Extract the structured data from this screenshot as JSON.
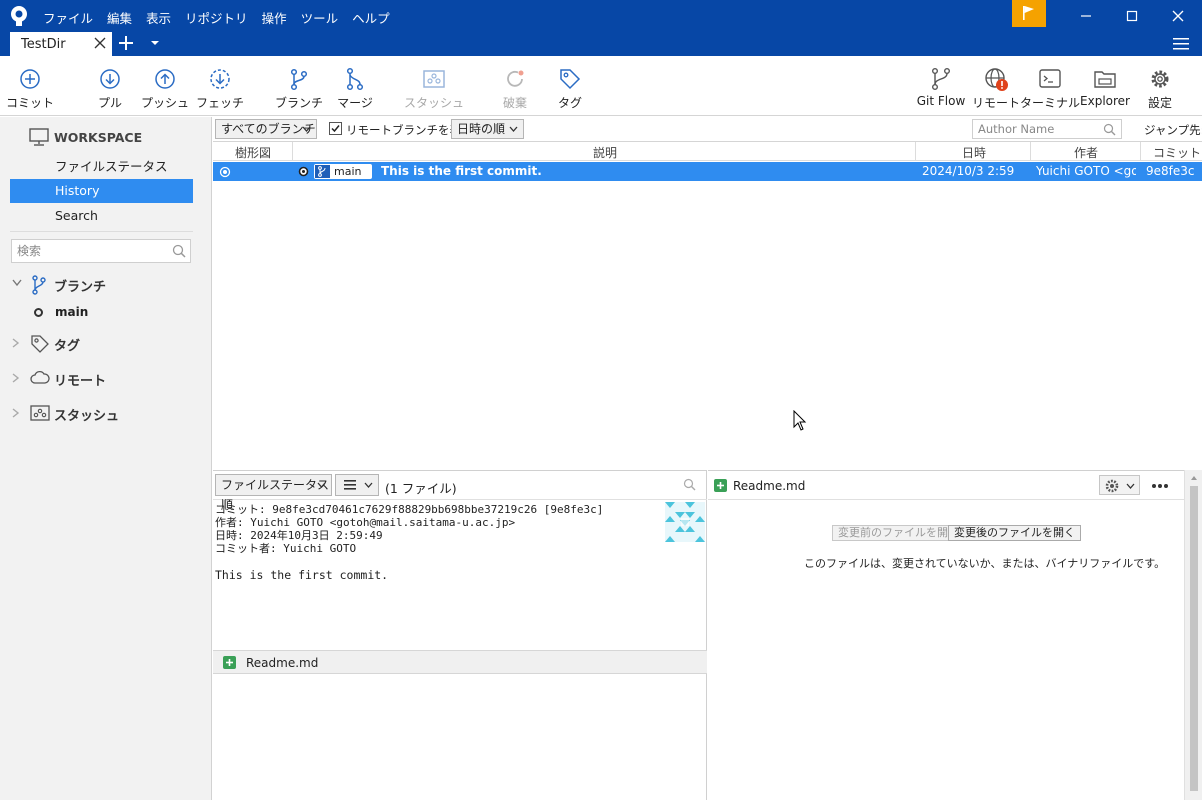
{
  "menu": [
    "ファイル",
    "編集",
    "表示",
    "リポジトリ",
    "操作",
    "ツール",
    "ヘルプ"
  ],
  "tab": {
    "label": "TestDir"
  },
  "toolbar": {
    "commit": "コミット",
    "pull": "プル",
    "push": "プッシュ",
    "fetch": "フェッチ",
    "branch": "ブランチ",
    "merge": "マージ",
    "stash": "スタッシュ",
    "discard": "破棄",
    "tag": "タグ",
    "gitflow": "Git Flow",
    "remote": "リモート",
    "terminal": "ターミナル",
    "explorer": "Explorer",
    "settings": "設定"
  },
  "sidebar": {
    "workspace": "WORKSPACE",
    "items": [
      "ファイルステータス",
      "History",
      "Search"
    ],
    "active": "History",
    "search_placeholder": "検索",
    "branches_label": "ブランチ",
    "branch_main": "main",
    "tags_label": "タグ",
    "remotes_label": "リモート",
    "stashes_label": "スタッシュ"
  },
  "filter": {
    "branches": "すべてのブランチ",
    "show_remote": "リモートブランチを表示",
    "order": "日時の順",
    "author_placeholder": "Author Name",
    "jump": "ジャンプ先:"
  },
  "history": {
    "columns": [
      "樹形図",
      "説明",
      "日時",
      "作者",
      "コミット"
    ],
    "rows": [
      {
        "branch": "main",
        "message": "This is the first commit.",
        "date": "2024/10/3  2:59",
        "author": "Yuichi GOTO <gotoh@mail.saitama-u.ac.jp>",
        "commit": "9e8fe3c"
      }
    ]
  },
  "details": {
    "sort": "ファイルステータス順",
    "count": "(1 ファイル)",
    "info_commit": "コミット: 9e8fe3cd70461c7629f88829bb698bbe37219c26 [9e8fe3c]",
    "info_author": "作者: Yuichi GOTO <gotoh@mail.saitama-u.ac.jp>",
    "info_date": "日時: 2024年10月3日 2:59:49",
    "info_committer": "コミット者: Yuichi GOTO",
    "message": "This is the first commit.",
    "file": "Readme.md"
  },
  "diff": {
    "file": "Readme.md",
    "open_before": "変更前のファイルを開く",
    "open_after": "変更後のファイルを開く",
    "no_change": "このファイルは、変更されていないか、または、バイナリファイルです。"
  },
  "colors": {
    "titlebar": "#0747a6",
    "selection": "#2f8cf0",
    "flag": "#f5a200",
    "added": "#3aa057"
  }
}
